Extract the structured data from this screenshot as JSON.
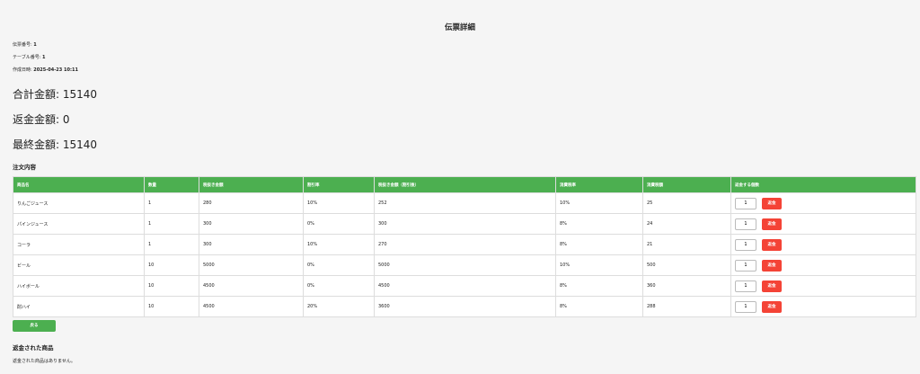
{
  "page": {
    "title": "伝票詳細"
  },
  "meta": {
    "slip_no_label": "伝票番号:",
    "slip_no": "1",
    "table_no_label": "テーブル番号:",
    "table_no": "1",
    "created_label": "作成日時:",
    "created": "2025-04-23 10:11"
  },
  "totals": {
    "total_label": "合計金額: ",
    "total": "15140",
    "refund_label": "返金金額: ",
    "refund": "0",
    "final_label": "最終金額: ",
    "final": "15140"
  },
  "order": {
    "section_title": "注文内容",
    "headers": [
      "商品名",
      "数量",
      "税抜き金額",
      "割引率",
      "税抜き金額（割引後）",
      "消費税率",
      "消費税額",
      "返金する個数"
    ],
    "rows": [
      [
        "りんごジュース",
        "1",
        "280",
        "10%",
        "252",
        "10%",
        "25"
      ],
      [
        "パインジュース",
        "1",
        "300",
        "0%",
        "300",
        "8%",
        "24"
      ],
      [
        "コーラ",
        "1",
        "300",
        "10%",
        "270",
        "8%",
        "21"
      ],
      [
        "ビール",
        "10",
        "5000",
        "0%",
        "5000",
        "10%",
        "500"
      ],
      [
        "ハイボール",
        "10",
        "4500",
        "0%",
        "4500",
        "8%",
        "360"
      ],
      [
        "酎ハイ",
        "10",
        "4500",
        "20%",
        "3600",
        "8%",
        "288"
      ]
    ],
    "refund_qty_values": [
      "1",
      "1",
      "1",
      "1",
      "1",
      "1"
    ],
    "refund_button_label": "返金"
  },
  "back_button_label": "戻る",
  "refunded": {
    "section_title": "返金された商品",
    "empty_message": "返金された商品はありません。"
  },
  "colors": {
    "accent": "#4caf50",
    "danger": "#f44336",
    "background": "#f5f5f5"
  }
}
